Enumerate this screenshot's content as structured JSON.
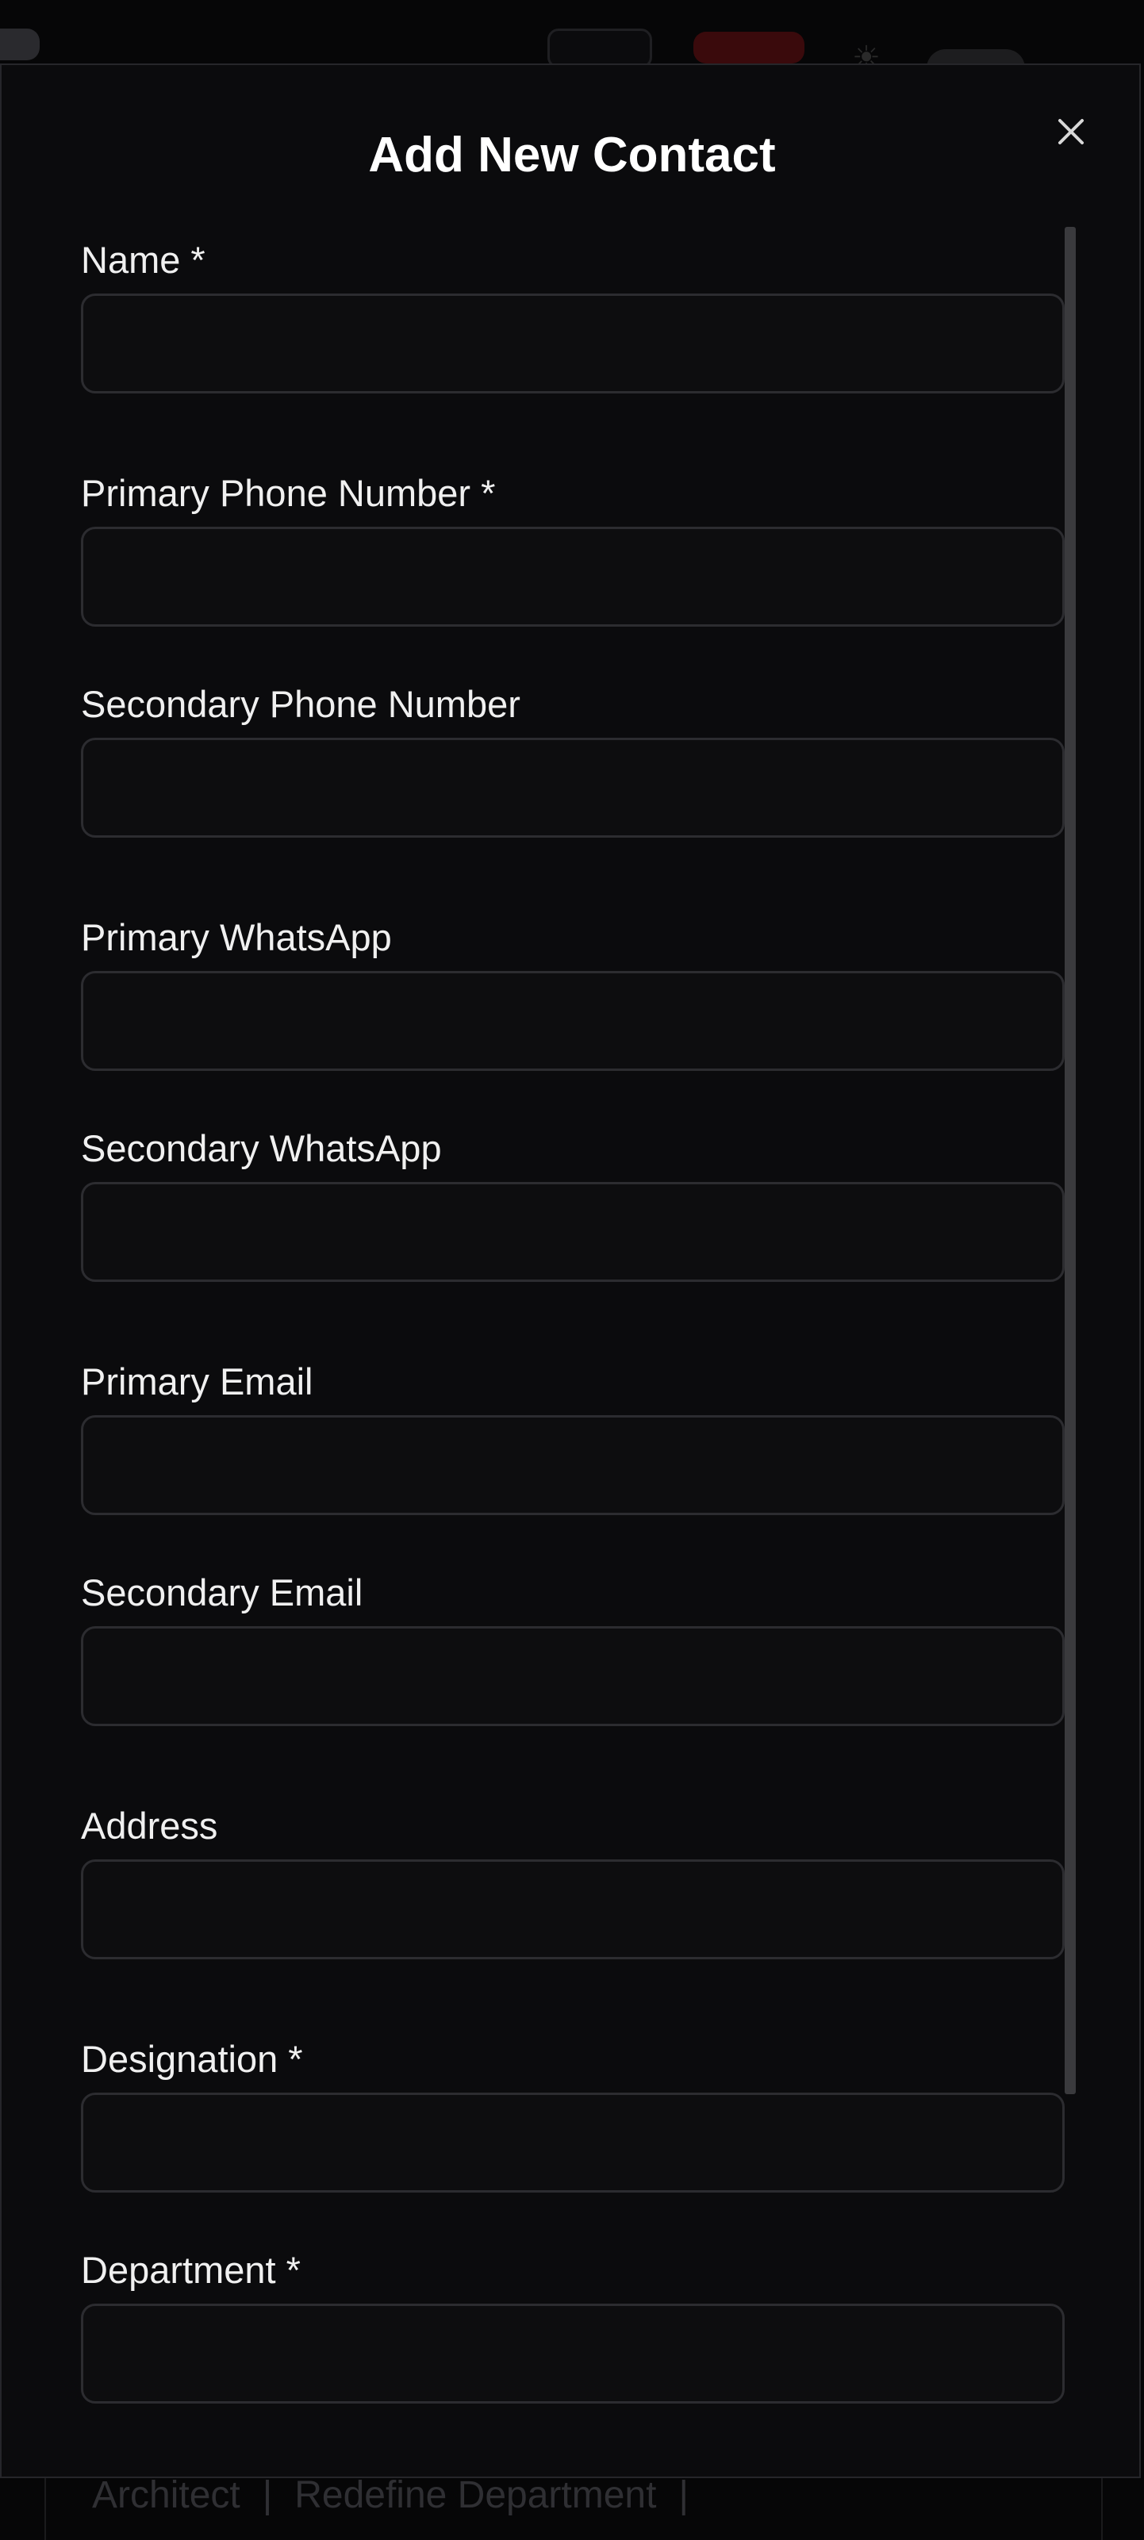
{
  "background": {
    "footer_links": [
      "Architect",
      "Redefine Department"
    ]
  },
  "modal": {
    "title": "Add New Contact",
    "close_icon": "close-icon",
    "fields": [
      {
        "label": "Name *",
        "value": "",
        "placeholder": ""
      },
      {
        "label": "Primary Phone Number *",
        "value": "",
        "placeholder": ""
      },
      {
        "label": "Secondary Phone Number",
        "value": "",
        "placeholder": ""
      },
      {
        "label": "Primary WhatsApp",
        "value": "",
        "placeholder": ""
      },
      {
        "label": "Secondary WhatsApp",
        "value": "",
        "placeholder": ""
      },
      {
        "label": "Primary Email",
        "value": "",
        "placeholder": ""
      },
      {
        "label": "Secondary Email",
        "value": "",
        "placeholder": ""
      },
      {
        "label": "Address",
        "value": "",
        "placeholder": ""
      },
      {
        "label": "Designation *",
        "value": "",
        "placeholder": ""
      },
      {
        "label": "Department *",
        "value": "",
        "placeholder": ""
      }
    ]
  },
  "colors": {
    "modal_background": "#0b0b0d",
    "input_border": "#2c2c30",
    "text": "#f0f0f0"
  }
}
